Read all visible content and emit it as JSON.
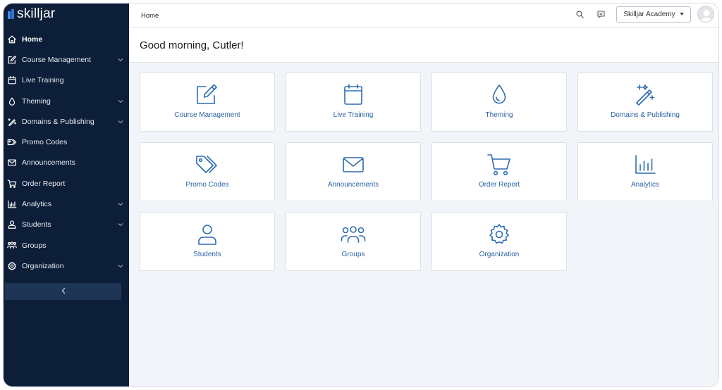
{
  "brand": {
    "logo_text": "skilljar",
    "accent": "#2e6bb3",
    "sidebar_bg": "#0d1e38"
  },
  "sidebar": {
    "items": [
      {
        "label": "Home",
        "icon": "home-icon",
        "active": true,
        "expandable": false
      },
      {
        "label": "Course Management",
        "icon": "edit-icon",
        "active": false,
        "expandable": true
      },
      {
        "label": "Live Training",
        "icon": "calendar-icon",
        "active": false,
        "expandable": false
      },
      {
        "label": "Theming",
        "icon": "droplet-icon",
        "active": false,
        "expandable": true
      },
      {
        "label": "Domains & Publishing",
        "icon": "magic-wand-icon",
        "active": false,
        "expandable": true
      },
      {
        "label": "Promo Codes",
        "icon": "tags-icon",
        "active": false,
        "expandable": false
      },
      {
        "label": "Announcements",
        "icon": "envelope-icon",
        "active": false,
        "expandable": false
      },
      {
        "label": "Order Report",
        "icon": "cart-icon",
        "active": false,
        "expandable": false
      },
      {
        "label": "Analytics",
        "icon": "bar-chart-icon",
        "active": false,
        "expandable": true
      },
      {
        "label": "Students",
        "icon": "person-icon",
        "active": false,
        "expandable": true
      },
      {
        "label": "Groups",
        "icon": "people-icon",
        "active": false,
        "expandable": false
      },
      {
        "label": "Organization",
        "icon": "gear-icon",
        "active": false,
        "expandable": true
      }
    ],
    "collapse_icon": "chevron-left-icon"
  },
  "topbar": {
    "breadcrumb": "Home",
    "search_icon": "search-icon",
    "feedback_icon": "chat-icon",
    "academy_select": "Skilljar Academy",
    "avatar_icon": "avatar-icon"
  },
  "main": {
    "greeting": "Good morning, Cutler!",
    "cards": [
      {
        "label": "Course Management",
        "icon": "edit-icon"
      },
      {
        "label": "Live Training",
        "icon": "calendar-icon"
      },
      {
        "label": "Theming",
        "icon": "droplet-icon"
      },
      {
        "label": "Domains & Publishing",
        "icon": "magic-wand-icon"
      },
      {
        "label": "Promo Codes",
        "icon": "tags-icon"
      },
      {
        "label": "Announcements",
        "icon": "envelope-icon"
      },
      {
        "label": "Order Report",
        "icon": "cart-icon"
      },
      {
        "label": "Analytics",
        "icon": "bar-chart-icon"
      },
      {
        "label": "Students",
        "icon": "person-icon"
      },
      {
        "label": "Groups",
        "icon": "people-icon"
      },
      {
        "label": "Organization",
        "icon": "gear-icon"
      }
    ]
  }
}
